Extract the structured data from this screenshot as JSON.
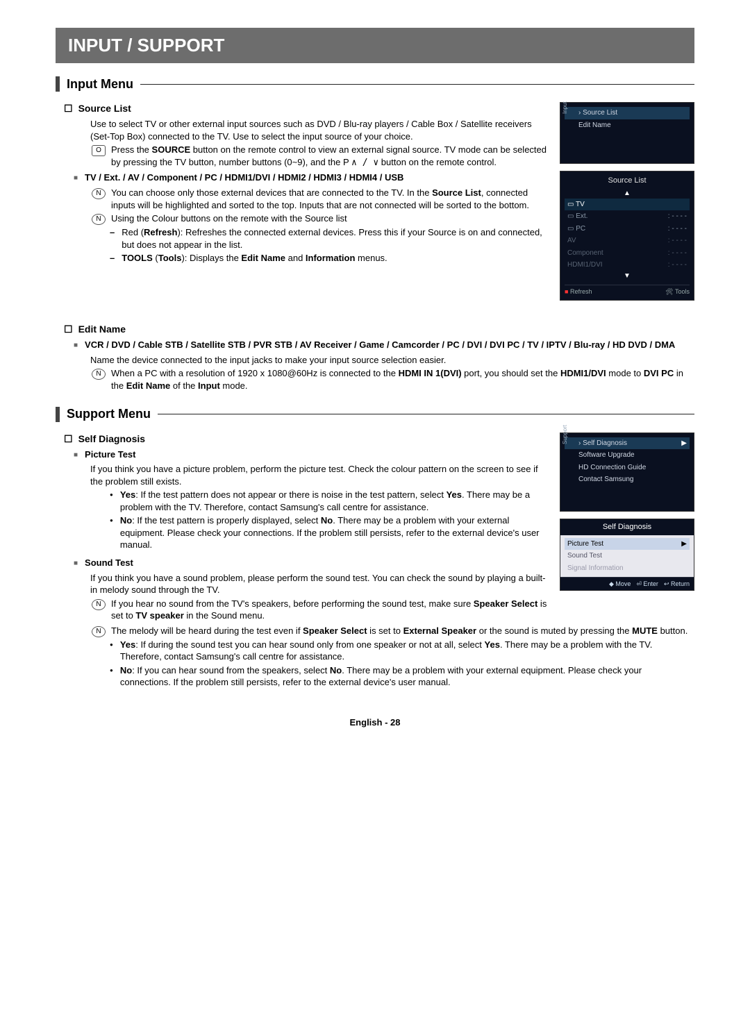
{
  "banner": "INPUT / SUPPORT",
  "input_menu": "Input Menu",
  "source_list": {
    "title": "Source List",
    "desc": "Use to select TV or other external input sources such as DVD / Blu-ray players / Cable Box / Satellite receivers (Set-Top Box) connected to the TV. Use to select the input source of your choice.",
    "note1_prefix": "Press the ",
    "note1_b1": "SOURCE",
    "note1_mid": " button on the remote control to view an external signal source. TV mode can be selected by pressing the TV button, number buttons (0~9), and the P ",
    "note1_suffix": " button on the remote control.",
    "sources_line": "TV / Ext. / AV / Component / PC / HDMI1/DVI / HDMI2 / HDMI3 / HDMI4 / USB",
    "note2_a": "You can choose only those external devices that are connected to the TV. In the ",
    "note2_b": "Source List",
    "note2_c": ", connected inputs will be highlighted and sorted to the top. Inputs that are not connected will be sorted to the bottom.",
    "note3": "Using the Colour buttons on the remote with the Source list",
    "dash1_a": "Red (",
    "dash1_b": "Refresh",
    "dash1_c": "): Refreshes the connected external devices. Press this if your Source is on and connected, but does not appear in the list.",
    "dash2_a": "TOOLS",
    "dash2_b": " (",
    "dash2_c": "Tools",
    "dash2_d": "): Displays the ",
    "dash2_e": "Edit Name",
    "dash2_f": " and ",
    "dash2_g": "Information",
    "dash2_h": " menus."
  },
  "edit_name": {
    "title": "Edit Name",
    "list": "VCR / DVD / Cable STB / Satellite STB / PVR STB / AV Receiver / Game / Camcorder / PC / DVI / DVI PC / TV / IPTV / Blu-ray / HD DVD / DMA",
    "desc": "Name the device connected to the input jacks to make your input source selection easier.",
    "note_a": "When a PC with a resolution of 1920 x 1080@60Hz is connected to the ",
    "note_b": "HDMI IN 1(DVI)",
    "note_c": " port, you should set the ",
    "note_d": "HDMI1/DVI",
    "note_e": " mode to ",
    "note_f": "DVI PC",
    "note_g": " in the ",
    "note_h": "Edit Name",
    "note_i": " of the ",
    "note_j": "Input",
    "note_k": " mode."
  },
  "support_menu": "Support Menu",
  "self_diag": {
    "title": "Self Diagnosis",
    "pic_test": "Picture Test",
    "pic_desc": "If you think you have a picture problem, perform the picture test. Check the colour pattern on the screen to see if the problem still exists.",
    "pic_yes_a": "Yes",
    "pic_yes_b": ": If the test pattern does not appear or there is noise in the test pattern, select ",
    "pic_yes_c": "Yes",
    "pic_yes_d": ". There may be a problem with the TV. Therefore, contact Samsung's call centre for assistance.",
    "pic_no_a": "No",
    "pic_no_b": ": If the test pattern is properly displayed, select ",
    "pic_no_c": "No",
    "pic_no_d": ". There may be a problem with your external equipment. Please check your connections. If the problem still persists, refer to the external device's user manual.",
    "sound_test": "Sound Test",
    "sound_desc": "If you think you have a sound problem, please perform the sound test. You can check the sound by playing a built-in melody sound through the TV.",
    "snote1_a": "If you hear no sound from the TV's speakers, before performing the sound test, make sure ",
    "snote1_b": "Speaker Select",
    "snote1_c": " is set to ",
    "snote1_d": "TV speaker",
    "snote1_e": " in the Sound menu.",
    "snote2_a": "The melody will be heard during the test even if ",
    "snote2_b": "Speaker Select",
    "snote2_c": " is set to ",
    "snote2_d": "External Speaker",
    "snote2_e": " or the sound is muted by pressing the ",
    "snote2_f": "MUTE",
    "snote2_g": " button.",
    "syes_a": "Yes",
    "syes_b": ": If during the sound test you can hear sound only from one speaker or not at all, select ",
    "syes_c": "Yes",
    "syes_d": ". There may be a problem with the TV. Therefore, contact Samsung's call centre for assistance.",
    "sno_a": "No",
    "sno_b": ": If you can hear sound from the speakers, select ",
    "sno_c": "No",
    "sno_d": ". There may be a problem with your external equipment. Please check your connections. If the problem still persists, refer to the external device's user manual."
  },
  "shot1": {
    "row1": "› Source List",
    "row2": "Edit Name",
    "side": "Input"
  },
  "shot2": {
    "title": "Source List",
    "tv": "TV",
    "ext": "Ext.",
    "ext_v": ": - - - -",
    "pc": "PC",
    "pc_v": ": - - - -",
    "av": "AV",
    "av_v": ": - - - -",
    "comp": "Component",
    "comp_v": ": - - - -",
    "hdmi": "HDMI1/DVI",
    "hdmi_v": ": - - - -",
    "refresh": "Refresh",
    "tools": "Tools"
  },
  "shot3": {
    "row1": "› Self Diagnosis",
    "row2": "Software Upgrade",
    "row3": "HD Connection Guide",
    "row4": "Contact Samsung",
    "side": "Support"
  },
  "shot4": {
    "title": "Self Diagnosis",
    "r1": "Picture Test",
    "r2": "Sound Test",
    "r3": "Signal Information",
    "foot_move": "Move",
    "foot_enter": "Enter",
    "foot_return": "Return"
  },
  "footer": "English - 28"
}
